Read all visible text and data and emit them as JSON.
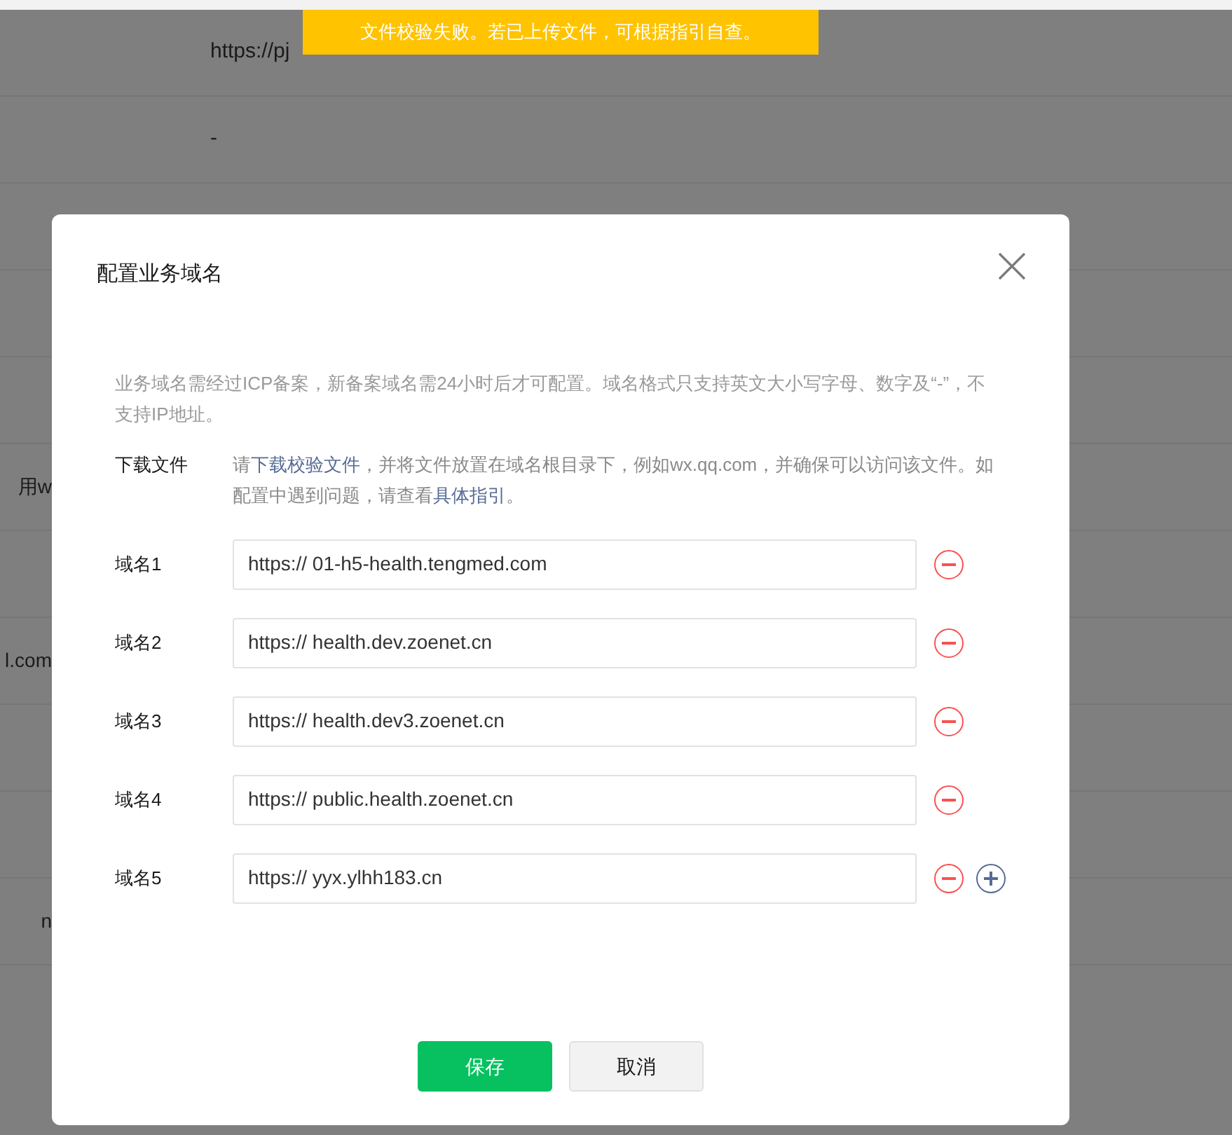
{
  "toast": {
    "text": "文件校验失败。若已上传文件，可根据指引自查。"
  },
  "background": {
    "rows": [
      {
        "value": "https://pj"
      },
      {
        "value": "-"
      },
      {},
      {},
      {},
      {
        "side": "用w"
      },
      {},
      {
        "side": "l.com"
      },
      {},
      {},
      {
        "side": "n"
      }
    ]
  },
  "dialog": {
    "title": "配置业务域名",
    "notice": "业务域名需经过ICP备案，新备案域名需24小时后才可配置。域名格式只支持英文大小写字母、数字及“-”，不支持IP地址。",
    "download": {
      "label": "下载文件",
      "text_before": "请",
      "link": "下载校验文件",
      "text_middle": "，并将文件放置在域名根目录下，例如wx.qq.com，并确保可以访问该文件。如配置中遇到问题，请查看",
      "guide_link": "具体指引",
      "text_after": "。"
    },
    "domains": [
      {
        "label": "域名1",
        "value": "https:// 01-h5-health.tengmed.com",
        "can_add": false
      },
      {
        "label": "域名2",
        "value": "https:// health.dev.zoenet.cn",
        "can_add": false
      },
      {
        "label": "域名3",
        "value": "https:// health.dev3.zoenet.cn",
        "can_add": false
      },
      {
        "label": "域名4",
        "value": "https:// public.health.zoenet.cn",
        "can_add": false
      },
      {
        "label": "域名5",
        "value": "https:// yyx.ylhh183.cn",
        "can_add": true
      }
    ],
    "buttons": [
      {
        "label": "保存",
        "kind": "primary"
      },
      {
        "label": "取消",
        "kind": "default"
      }
    ]
  }
}
